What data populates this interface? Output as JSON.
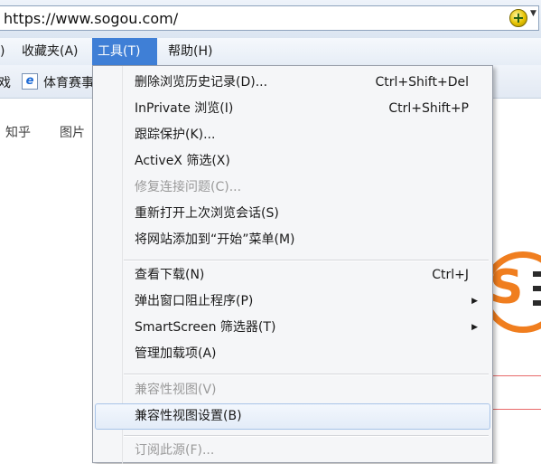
{
  "address_bar": {
    "url": "https://www.sogou.com/"
  },
  "menu_bar": {
    "items": [
      {
        "label": "收藏夹(A)"
      },
      {
        "label": "工具(T)"
      },
      {
        "label": "帮助(H)"
      }
    ],
    "left_fragment": ")"
  },
  "favorites_bar": {
    "left_fragment": "戏",
    "item_label": "体育赛事"
  },
  "page": {
    "links": [
      "知乎",
      "图片"
    ]
  },
  "tools_menu": {
    "items": [
      {
        "label": "删除浏览历史记录(D)...",
        "shortcut": "Ctrl+Shift+Del"
      },
      {
        "label": "InPrivate 浏览(I)",
        "shortcut": "Ctrl+Shift+P"
      },
      {
        "label": "跟踪保护(K)..."
      },
      {
        "label": "ActiveX 筛选(X)"
      },
      {
        "label": "修复连接问题(C)...",
        "disabled": true
      },
      {
        "label": "重新打开上次浏览会话(S)"
      },
      {
        "label": "将网站添加到“开始”菜单(M)"
      },
      {
        "label": "查看下载(N)",
        "shortcut": "Ctrl+J"
      },
      {
        "label": "弹出窗口阻止程序(P)",
        "submenu": true
      },
      {
        "label": "SmartScreen 筛选器(T)",
        "submenu": true
      },
      {
        "label": "管理加载项(A)"
      },
      {
        "label": "兼容性视图(V)",
        "disabled": true
      },
      {
        "label": "兼容性视图设置(B)",
        "highlighted": true
      },
      {
        "label": "订阅此源(F)...",
        "disabled": true
      }
    ]
  },
  "colors": {
    "menu_active": "#3f7fd6",
    "logo_orange": "#f07e1f"
  }
}
